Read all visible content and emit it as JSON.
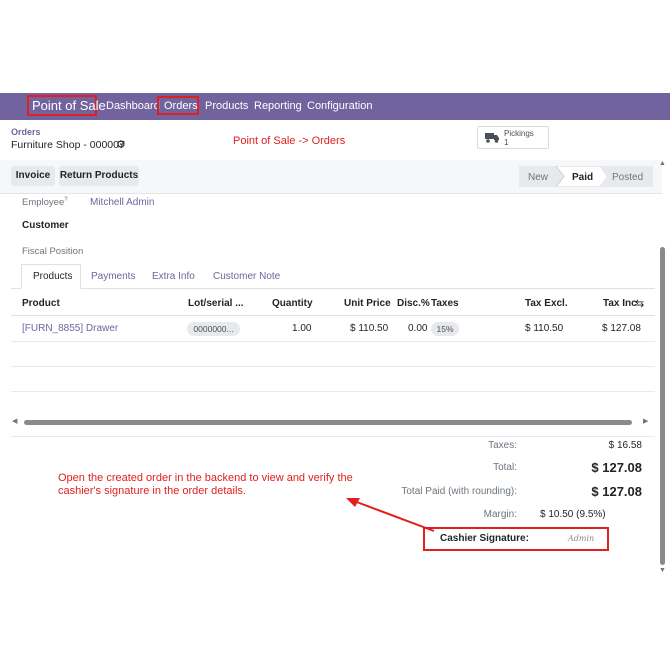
{
  "navbar": {
    "app_name": "Point of Sale",
    "menu": [
      "Dashboard",
      "Orders",
      "Products",
      "Reporting",
      "Configuration"
    ]
  },
  "breadcrumb": {
    "parent": "Orders",
    "current": "Furniture Shop - 000007"
  },
  "annotation_top": "Point of Sale -> Orders",
  "pickings": {
    "label": "Pickings",
    "count": "1"
  },
  "actions": {
    "invoice": "Invoice",
    "return_products": "Return Products"
  },
  "statusbar": [
    "New",
    "Paid",
    "Posted"
  ],
  "form": {
    "employee_label": "Employee",
    "employee_tooltip": "?",
    "employee_value": "Mitchell Admin",
    "customer_label": "Customer",
    "fiscal_position_label": "Fiscal Position"
  },
  "tabs": [
    "Products",
    "Payments",
    "Extra Info",
    "Customer Note"
  ],
  "table": {
    "headers": [
      "Product",
      "Lot/serial ...",
      "Quantity",
      "Unit Price",
      "Disc.%",
      "Taxes",
      "Tax Excl.",
      "Tax Inc"
    ],
    "rows": [
      {
        "product": "[FURN_8855] Drawer",
        "lot": "0000000...",
        "quantity": "1.00",
        "unit_price": "$ 110.50",
        "discount": "0.00",
        "taxes": "15%",
        "tax_excl": "$ 110.50",
        "tax_inc": "$ 127.08"
      }
    ]
  },
  "summary": {
    "taxes_label": "Taxes:",
    "taxes_value": "$ 16.58",
    "total_label": "Total:",
    "total_value": "$ 127.08",
    "paid_label": "Total Paid (with rounding):",
    "paid_value": "$ 127.08",
    "margin_label": "Margin:",
    "margin_value": "$ 10.50 (9.5%)",
    "signature_label": "Cashier Signature:",
    "signature_value": "Admin"
  },
  "annotation_bottom": "Open the created order in the backend to view and verify the cashier's signature in the order details.",
  "colors": {
    "brand": "#71639e",
    "highlight": "#e02020"
  }
}
